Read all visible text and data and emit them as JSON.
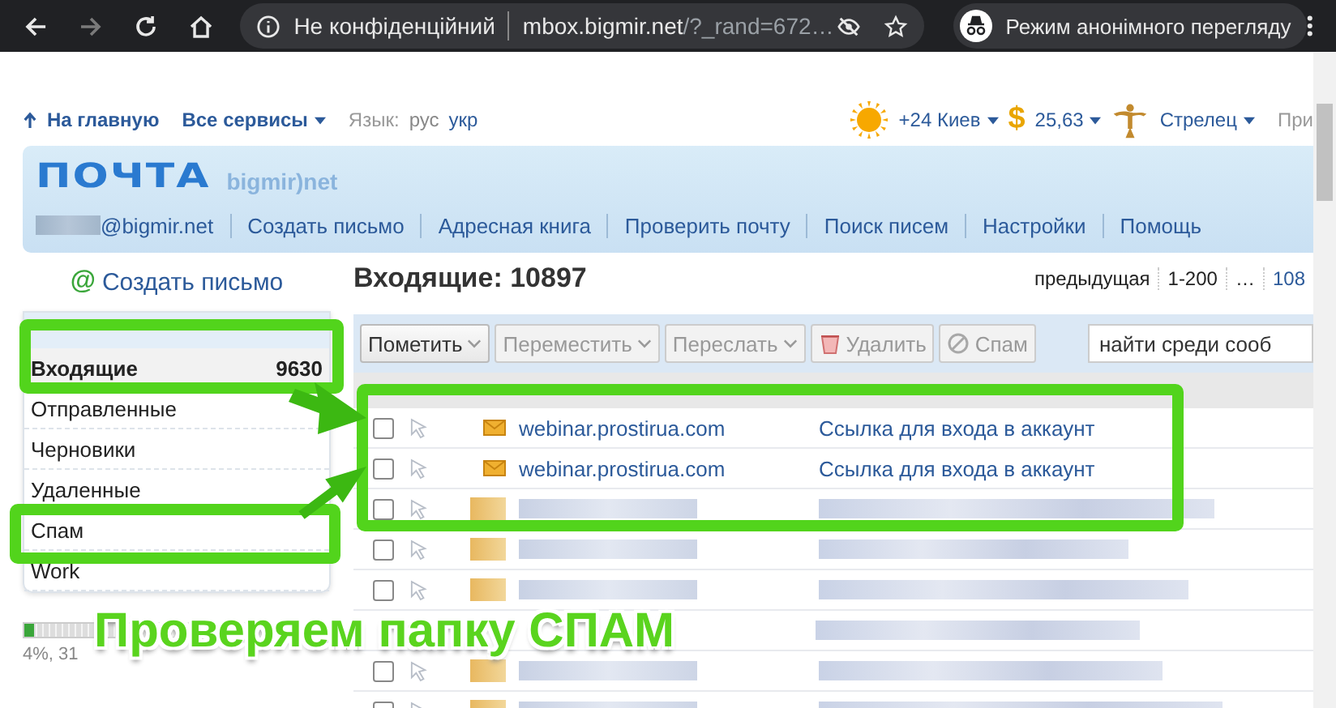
{
  "browser": {
    "nav_buttons": [
      {
        "kind": "back",
        "disabled": false
      },
      {
        "kind": "forward",
        "disabled": true
      },
      {
        "kind": "reload",
        "disabled": false
      },
      {
        "kind": "home",
        "disabled": false
      }
    ],
    "security_label": "Не конфіденційний",
    "url_host": "mbox.bigmir.net",
    "url_rest": "/?_rand=672…",
    "incognito_label": "Режим анонімного перегляду"
  },
  "top_links": {
    "home": "На главную",
    "services": "Все сервисы",
    "language_label": "Язык:",
    "languages": [
      {
        "label": "рус",
        "selected": true
      },
      {
        "label": "укр",
        "selected": false
      }
    ],
    "weather": "+24 Киев",
    "currency_symbol": "$",
    "currency": "25,63",
    "horoscope": "Стрелец",
    "cut_link": "При"
  },
  "header": {
    "logo": "ПОЧТА",
    "logo_brand": "bigmir)net",
    "account": "@bigmir.net",
    "nav": [
      "Создать письмо",
      "Адресная книга",
      "Проверить почту",
      "Поиск писем",
      "Настройки",
      "Помощь"
    ]
  },
  "sidebar": {
    "compose_icon": "@",
    "compose": "Создать письмо",
    "folders": [
      {
        "label": "Входящие",
        "count": "9630",
        "selected": true
      },
      {
        "label": "Отправленные",
        "selected": false
      },
      {
        "label": "Черновики",
        "selected": false
      },
      {
        "label": "Удаленные",
        "selected": false
      },
      {
        "label": "Спам",
        "selected": false
      },
      {
        "label": "Work",
        "selected": false
      }
    ],
    "quota": {
      "level": 0.04,
      "text": "4%, 31"
    }
  },
  "inbox": {
    "title": "Входящие: 10897",
    "pager": [
      {
        "label": "предыдущая",
        "kind": "text"
      },
      {
        "label": "1-200",
        "kind": "current"
      },
      {
        "label": "…",
        "kind": "text"
      },
      {
        "label": "108",
        "kind": "link"
      }
    ],
    "toolbar": [
      {
        "label": "Пометить",
        "kind": "dropdown",
        "disabled": false
      },
      {
        "label": "Переместить",
        "kind": "dropdown",
        "disabled": true
      },
      {
        "label": "Переслать",
        "kind": "dropdown",
        "disabled": true
      },
      {
        "label": "Удалить",
        "kind": "delete",
        "disabled": true
      },
      {
        "label": "Спам",
        "kind": "spam",
        "disabled": true
      }
    ],
    "search": {
      "placeholder": "найти среди сооб"
    },
    "messages": [
      {
        "kind": "message",
        "checked": false,
        "sender": "webinar.prostirua.com",
        "subject": "Ссылка для входа в аккаунт"
      },
      {
        "kind": "message",
        "checked": false,
        "sender": "webinar.prostirua.com",
        "subject": "Ссылка для входа в аккаунт"
      },
      {
        "kind": "blurred",
        "checked": false
      },
      {
        "kind": "blurred",
        "checked": false
      },
      {
        "kind": "blurred",
        "checked": false
      },
      {
        "kind": "covered"
      },
      {
        "kind": "blurred",
        "checked": false
      },
      {
        "kind": "blurred",
        "checked": false
      }
    ]
  },
  "annotation": {
    "caption": "Проверяем папку СПАМ"
  }
}
